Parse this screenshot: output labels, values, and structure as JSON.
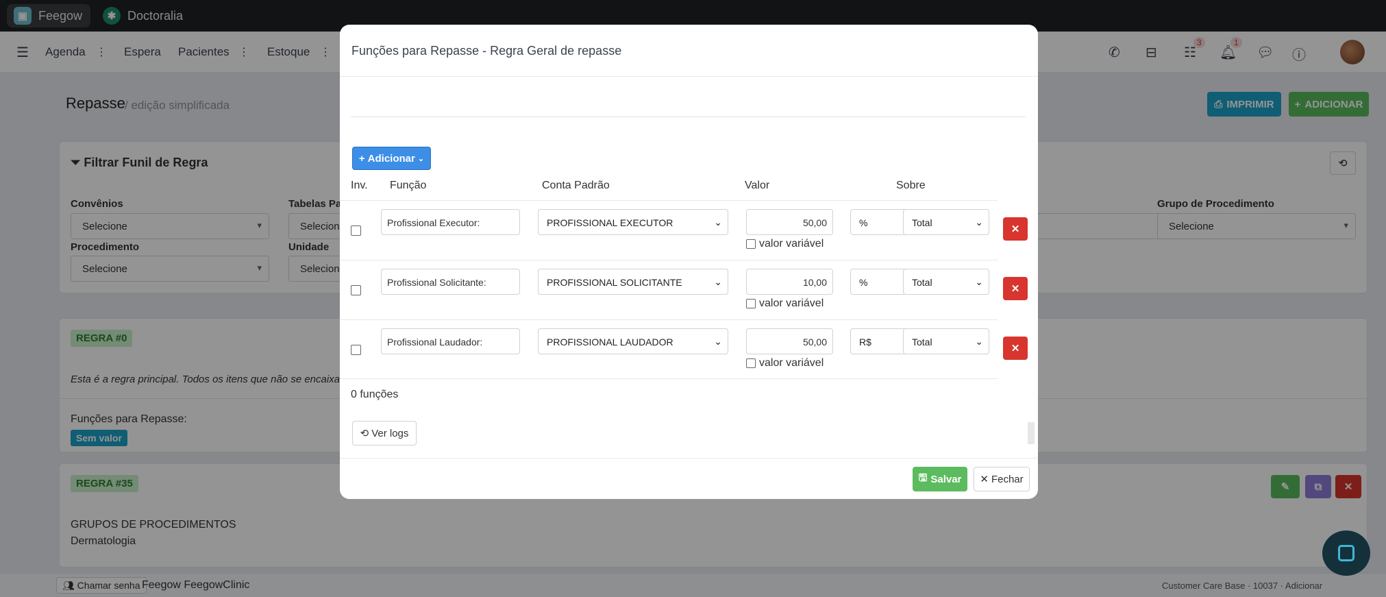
{
  "browser": {
    "tabs": [
      {
        "label": "Feegow"
      },
      {
        "label": "Doctoralia"
      }
    ]
  },
  "nav": {
    "items": [
      "Agenda",
      "Espera",
      "Pacientes",
      "Estoque"
    ],
    "badges": {
      "tasks": "3",
      "notifications": "1"
    }
  },
  "page": {
    "breadcrumb_main": "Repasse",
    "breadcrumb_sep": "/",
    "breadcrumb_sub": "/ edição simplificada",
    "print_label": "IMPRIMIR",
    "add_label": "ADICIONAR",
    "filter_title": "Filtrar Funil de Regra",
    "filters": [
      {
        "label": "Convênios",
        "value": "Selecione"
      },
      {
        "label": "Tabelas Part",
        "value": "Selecione"
      },
      {
        "label": "Grupo de Procedimento",
        "value": "Selecione"
      },
      {
        "label": "Procedimento",
        "value": "Selecione"
      },
      {
        "label": "Unidade",
        "value": "Selecione"
      }
    ],
    "rule0": {
      "tag": "REGRA #0",
      "description": "Esta é a regra principal. Todos os itens que não se encaixare",
      "funcs_label": "Funções para Repasse:",
      "funcs_value": "Sem valor"
    },
    "rule35": {
      "tag": "REGRA #35",
      "group_title": "GRUPOS DE PROCEDIMENTOS",
      "group_value": "Dermatologia"
    },
    "footer": {
      "call_label": "Chamar senha",
      "brand": "Feegow FeegowClinic",
      "right_text": "Customer Care Base · 10037 · Adicionar"
    }
  },
  "modal": {
    "title": "Funções para Repasse - Regra Geral de repasse",
    "add_button": "Adicionar",
    "headers": {
      "inv": "Inv.",
      "funcao": "Função",
      "conta": "Conta Padrão",
      "valor": "Valor",
      "sobre": "Sobre"
    },
    "rows": [
      {
        "funcao": "Profissional Executor:",
        "conta": "PROFISSIONAL EXECUTOR",
        "valor": "50,00",
        "variavel": "valor variável",
        "tipo": "%",
        "sobre": "Total"
      },
      {
        "funcao": "Profissional Solicitante:",
        "conta": "PROFISSIONAL SOLICITANTE",
        "valor": "10,00",
        "variavel": "valor variável",
        "tipo": "%",
        "sobre": "Total"
      },
      {
        "funcao": "Profissional Laudador:",
        "conta": "PROFISSIONAL LAUDADOR",
        "valor": "50,00",
        "variavel": "valor variável",
        "tipo": "R$",
        "sobre": "Total"
      }
    ],
    "count": "0 funções",
    "logs_button": "Ver logs",
    "save_button": "Salvar",
    "close_button": "Fechar"
  },
  "colors": {
    "primary": "#3d8ee6",
    "success": "#5bbb5e",
    "danger": "#d7352e",
    "info": "#1aa3c9"
  }
}
